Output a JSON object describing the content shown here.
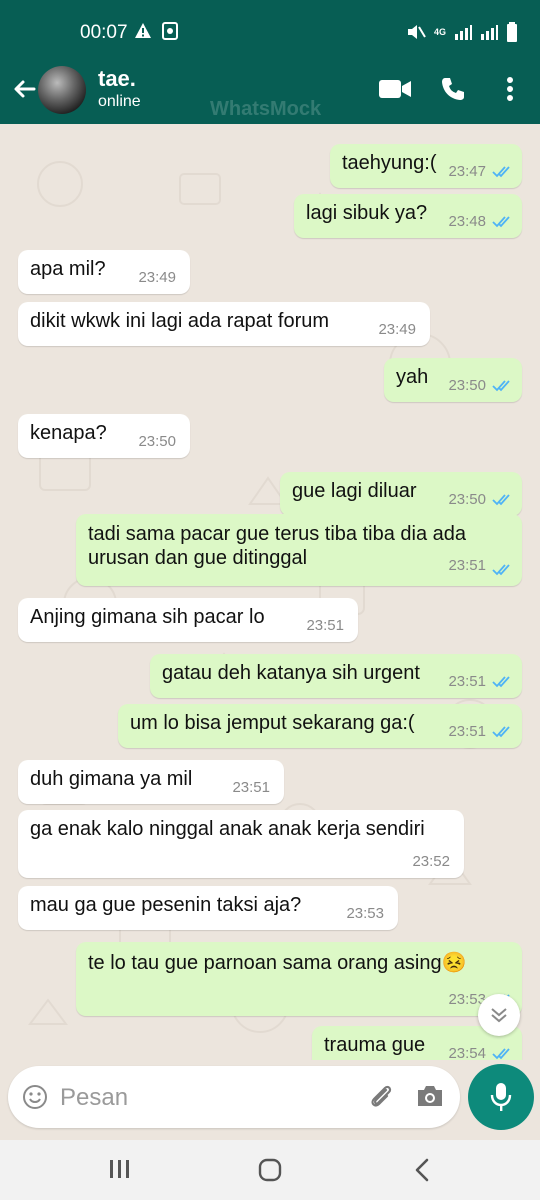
{
  "status_bar": {
    "time": "00:07",
    "network": "4G"
  },
  "header": {
    "contact_name": "tae.",
    "contact_status": "online",
    "watermark": "WhatsMock"
  },
  "messages": [
    {
      "dir": "out",
      "text": "taehyung:(",
      "time": "23:47"
    },
    {
      "dir": "out",
      "text": "lagi sibuk ya?",
      "time": "23:48"
    },
    {
      "dir": "in",
      "text": "apa mil?",
      "time": "23:49"
    },
    {
      "dir": "in",
      "text": "dikit wkwk ini lagi ada rapat forum",
      "time": "23:49"
    },
    {
      "dir": "out",
      "text": "yah",
      "time": "23:50"
    },
    {
      "dir": "in",
      "text": "kenapa?",
      "time": "23:50"
    },
    {
      "dir": "out",
      "text": "gue lagi diluar",
      "time": "23:50"
    },
    {
      "dir": "out",
      "text": "tadi sama pacar gue terus tiba tiba dia ada urusan dan gue ditinggal",
      "time": "23:51"
    },
    {
      "dir": "in",
      "text": "Anjing gimana sih pacar lo",
      "time": "23:51"
    },
    {
      "dir": "out",
      "text": "gatau deh katanya sih urgent",
      "time": "23:51"
    },
    {
      "dir": "out",
      "text": "um lo bisa jemput sekarang ga:(",
      "time": "23:51"
    },
    {
      "dir": "in",
      "text": "duh gimana ya mil",
      "time": "23:51"
    },
    {
      "dir": "in",
      "text": "ga enak kalo ninggal anak anak kerja sendiri",
      "time": "23:52"
    },
    {
      "dir": "in",
      "text": "mau ga gue pesenin taksi aja?",
      "time": "23:53"
    },
    {
      "dir": "out",
      "text": "te lo tau gue parnoan sama orang asing😣",
      "time": "23:53"
    },
    {
      "dir": "out",
      "text": "trauma gue",
      "time": "23:54"
    }
  ],
  "composer": {
    "placeholder": "Pesan"
  },
  "colors": {
    "header": "#075e54",
    "outgoing": "#dcf8c6",
    "incoming": "#ffffff",
    "tick_read": "#4fb3f6",
    "mic": "#0d8a7b"
  },
  "icons": [
    "back-arrow-icon",
    "video-call-icon",
    "phone-icon",
    "more-vert-icon",
    "emoji-icon",
    "attach-icon",
    "camera-icon",
    "mic-icon",
    "recent-apps-icon",
    "home-icon",
    "back-nav-icon"
  ]
}
